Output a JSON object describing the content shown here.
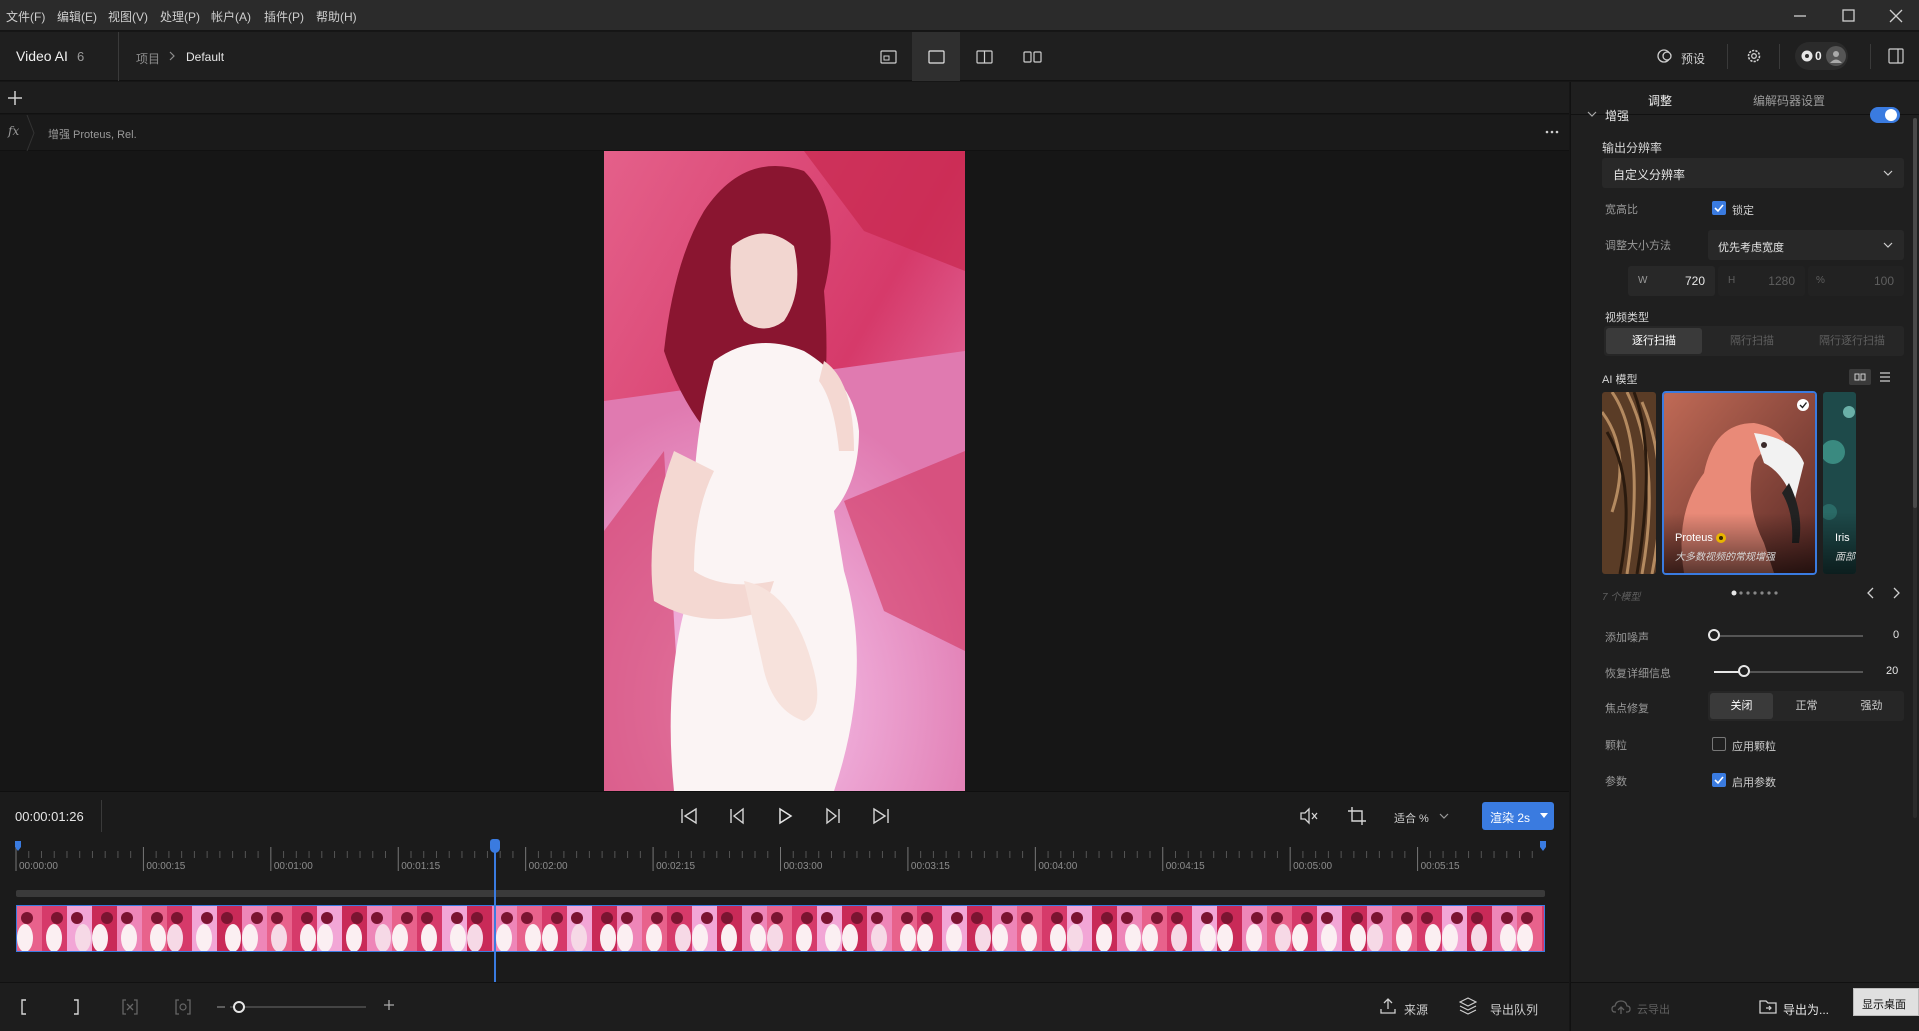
{
  "menu": [
    "文件(F)",
    "编辑(E)",
    "视图(V)",
    "处理(P)",
    "帐户(A)",
    "插件(P)",
    "帮助(H)"
  ],
  "app": {
    "name": "Video AI",
    "version": "6",
    "breadcrumb_root": "项目",
    "breadcrumb_current": "Default",
    "preset_label": "预设",
    "credits": "0"
  },
  "clip": {
    "effect_summary": "增强 Proteus, Rel."
  },
  "transport": {
    "timecode": "00:00:01:26",
    "zoom_label": "适合 %",
    "render_label": "渲染 2s"
  },
  "timeline": {
    "ticks": [
      "00:00:00",
      "00:00:15",
      "00:01:00",
      "00:01:15",
      "00:02:00",
      "00:02:15",
      "00:03:00",
      "00:03:15",
      "00:04:00",
      "00:04:15",
      "00:05:00",
      "00:05:15"
    ],
    "playhead_fraction": 0.313
  },
  "bottom": {
    "source_label": "来源",
    "queue_label": "导出队列",
    "cloud_label": "云导出",
    "export_label": "导出为...",
    "desktop_label": "显示桌面"
  },
  "panel": {
    "tabs": [
      "调整",
      "编解码器设置"
    ],
    "section_title": "增强",
    "enhance_enabled": true,
    "output_res_label": "输出分辨率",
    "output_res_value": "自定义分辨率",
    "aspect_label": "宽高比",
    "lock_label": "锁定",
    "lock_checked": true,
    "resize_label": "调整大小方法",
    "resize_value": "优先考虑宽度",
    "w_label": "W",
    "w_value": "720",
    "h_label": "H",
    "h_value": "1280",
    "pct_label": "%",
    "pct_value": "100",
    "video_type_label": "视频类型",
    "video_types": [
      "逐行扫描",
      "隔行扫描",
      "隔行逐行扫描"
    ],
    "ai_model_label": "AI 模型",
    "models": [
      {
        "name": "Proteus",
        "desc": "大多数视频的常规增强"
      },
      {
        "name": "Iris",
        "desc": "面部"
      }
    ],
    "model_count": "7 个模型",
    "add_noise_label": "添加噪声",
    "add_noise_value": "0",
    "add_noise_fraction": 0.0,
    "recover_label": "恢复详细信息",
    "recover_value": "20",
    "recover_fraction": 0.2,
    "focus_label": "焦点修复",
    "focus_options": [
      "关闭",
      "正常",
      "强劲"
    ],
    "grain_label": "颗粒",
    "grain_check": "应用颗粒",
    "grain_checked": false,
    "params_label": "参数",
    "params_check": "启用参数",
    "params_checked": true
  },
  "colors": {
    "accent": "#3a7be0",
    "gold": "#e8b400"
  }
}
